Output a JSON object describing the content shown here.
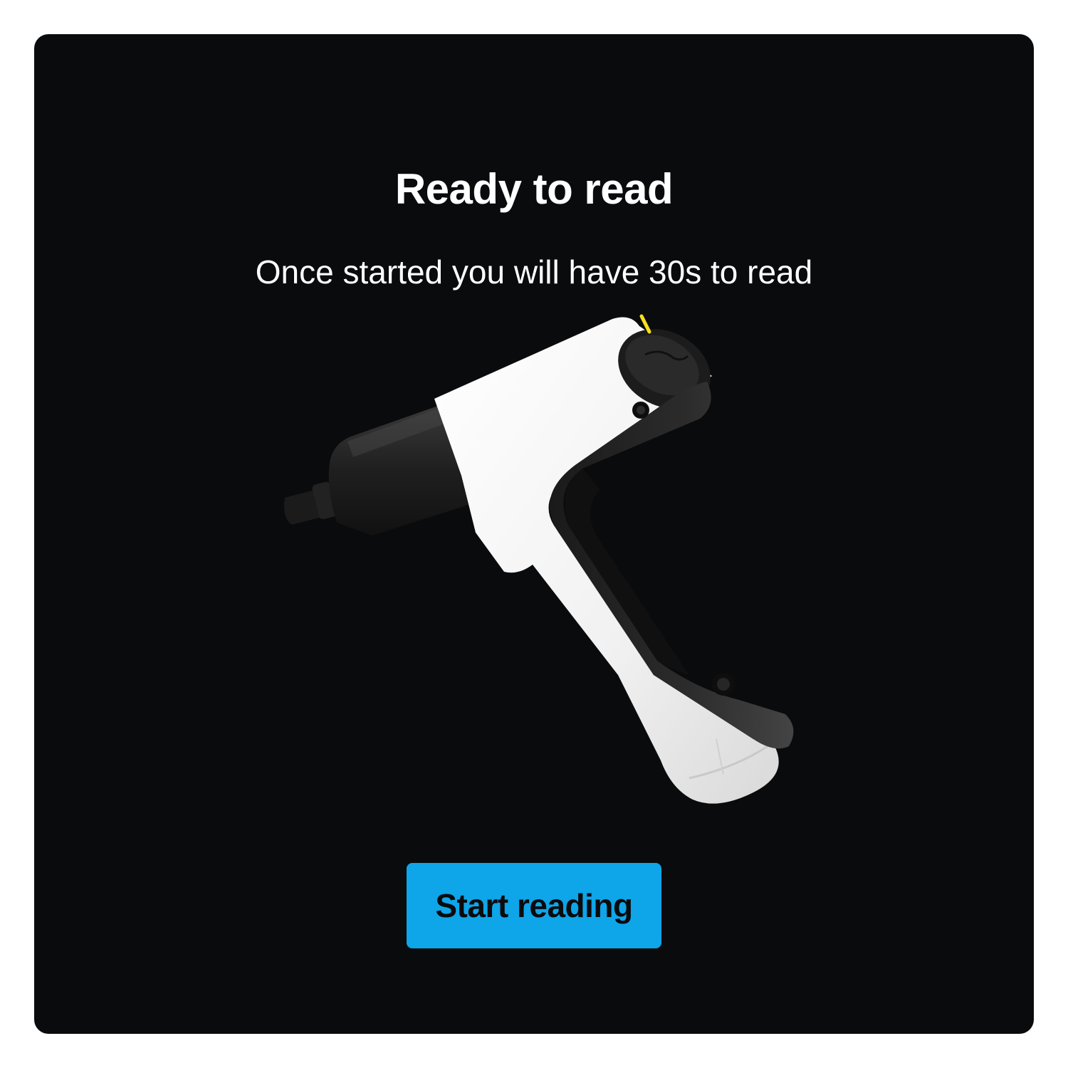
{
  "dialog": {
    "title": "Ready to read",
    "subtitle": "Once started you will have 30s to read",
    "device_image_alt": "handheld reader device",
    "start_button_label": "Start reading"
  },
  "colors": {
    "background": "#0a0b0d",
    "button": "#0ea5e9",
    "text": "#ffffff",
    "device_body": "#f4f4f4",
    "device_dark": "#1e1e1e",
    "indicator": "#f5e11d"
  }
}
